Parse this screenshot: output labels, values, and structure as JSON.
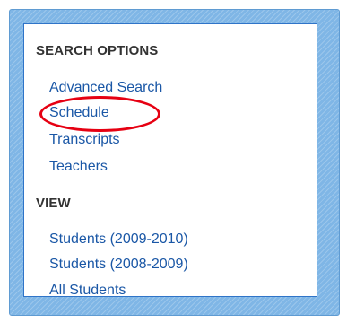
{
  "search_options": {
    "heading": "SEARCH OPTIONS",
    "items": [
      {
        "label": "Advanced Search"
      },
      {
        "label": "Schedule"
      },
      {
        "label": "Transcripts"
      },
      {
        "label": "Teachers"
      }
    ]
  },
  "view": {
    "heading": "VIEW",
    "items": [
      {
        "label": "Students (2009-2010)"
      },
      {
        "label": "Students (2008-2009)"
      },
      {
        "label": "All Students"
      }
    ]
  },
  "colors": {
    "frame": "#7fb6e6",
    "panel_border": "#2f74c8",
    "link": "#1a57a6",
    "highlight": "#e60012"
  }
}
